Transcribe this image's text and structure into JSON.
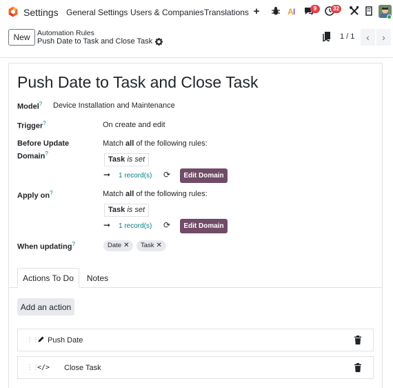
{
  "nav": {
    "app_name": "Settings",
    "menu": [
      "General Settings",
      "Users & Companies",
      "Translations"
    ],
    "messages_badge": "9",
    "activity_badge": "32"
  },
  "control_panel": {
    "new_label": "New",
    "breadcrumb_parent": "Automation Rules",
    "breadcrumb_current": "Push Date to Task and Close Task",
    "pager": "1 / 1"
  },
  "form": {
    "title": "Push Date to Task and Close Task",
    "model_label": "Model",
    "model_value": "Device Installation and Maintenance",
    "trigger_label": "Trigger",
    "trigger_value": "On create and edit",
    "before_update_label_1": "Before Update",
    "before_update_label_2": "Domain",
    "match_prefix": "Match",
    "match_all": "all",
    "match_suffix": "of the following rules:",
    "before_rule_field": "Task",
    "before_rule_op": "is set",
    "before_records": "1 record(s)",
    "edit_domain": "Edit Domain",
    "apply_on_label": "Apply on",
    "apply_rule_field": "Task",
    "apply_rule_op": "is set",
    "apply_records": "1 record(s)",
    "when_updating_label": "When updating",
    "when_updating_tags": [
      "Date",
      "Task"
    ],
    "help_mark": "?"
  },
  "tabs": {
    "actions": "Actions To Do",
    "notes": "Notes"
  },
  "actions": {
    "add_label": "Add an action",
    "items": [
      {
        "label": "Push Date",
        "icon": "pencil-icon"
      },
      {
        "label": "Close Task",
        "icon": "code-icon"
      }
    ]
  },
  "colors": {
    "primary": "#714b67",
    "link": "#017e84",
    "badge": "#e0434b"
  }
}
